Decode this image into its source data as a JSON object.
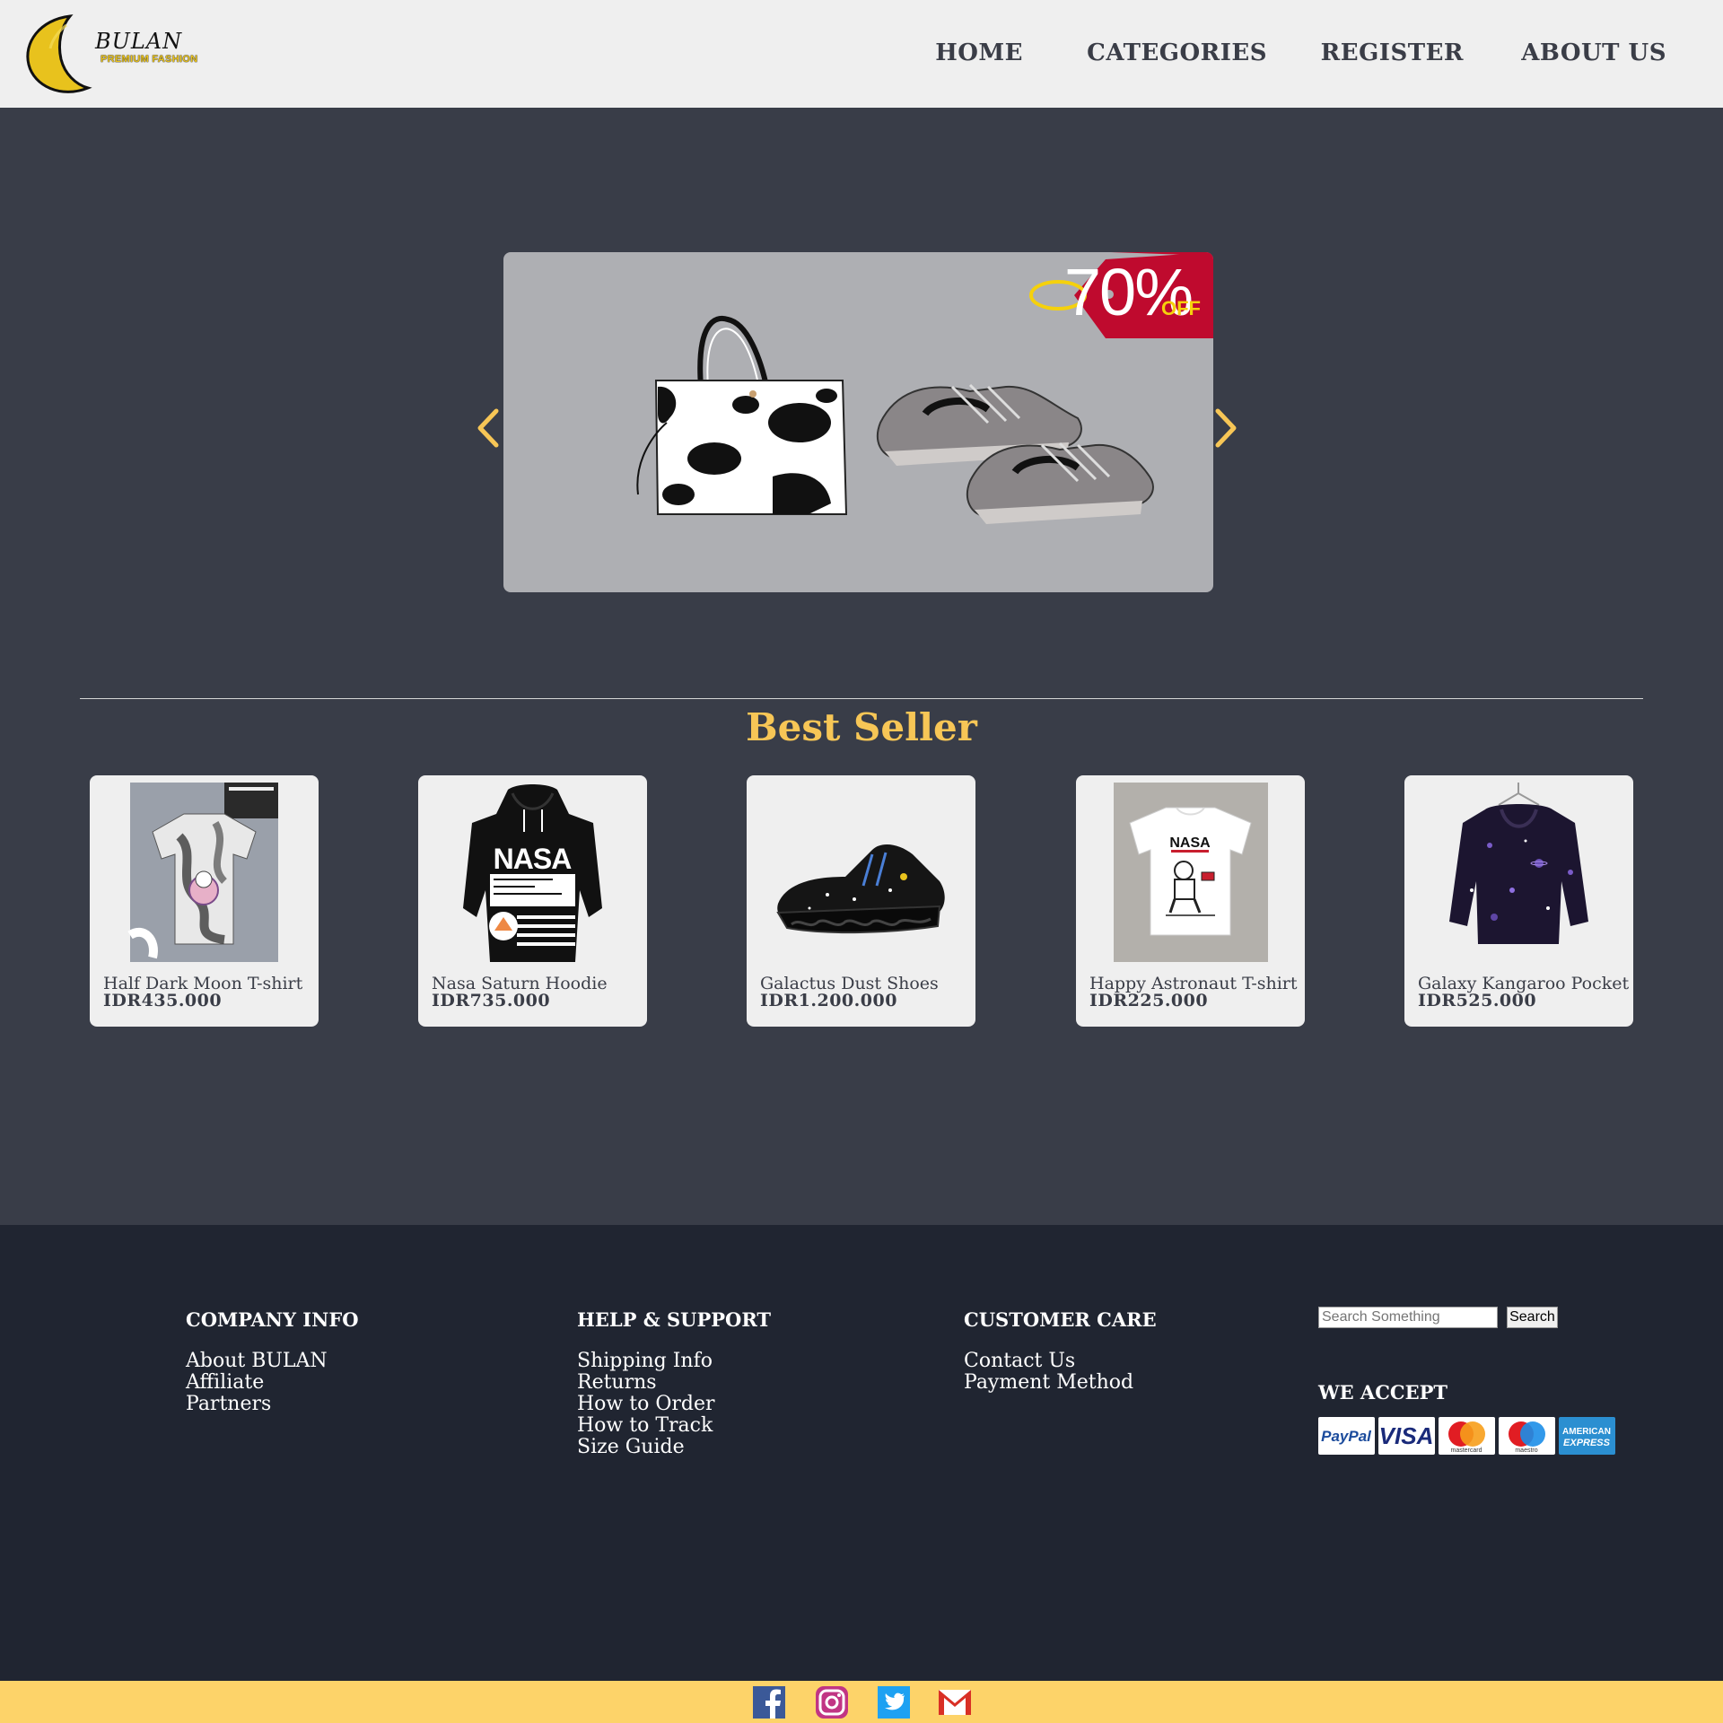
{
  "brand": {
    "name": "BULAN",
    "tagline": "PREMIUM FASHION",
    "accent_color": "#f7c656",
    "moon_color": "#e8c21d"
  },
  "nav": {
    "items": [
      {
        "label": "HOME"
      },
      {
        "label": "CATEGORIES"
      },
      {
        "label": "REGISTER"
      },
      {
        "label": "ABOUT US"
      }
    ]
  },
  "hero": {
    "discount_value": "70%",
    "discount_label": "OFF",
    "tag_color": "#bf0a2e",
    "prev_icon": "chevron-left-icon",
    "next_icon": "chevron-right-icon"
  },
  "best_seller": {
    "title": "Best Seller",
    "products": [
      {
        "name": "Half Dark Moon T-shirt",
        "price": "IDR435.000"
      },
      {
        "name": "Nasa Saturn Hoodie",
        "price": "IDR735.000"
      },
      {
        "name": "Galactus Dust Shoes",
        "price": "IDR1.200.000"
      },
      {
        "name": "Happy Astronaut T-shirt",
        "price": "IDR225.000"
      },
      {
        "name": "Galaxy Kangaroo Pocket",
        "price": "IDR525.000"
      }
    ]
  },
  "footer": {
    "company": {
      "title": "COMPANY INFO",
      "links": [
        "About BULAN",
        "Affiliate",
        "Partners"
      ]
    },
    "help": {
      "title": "HELP & SUPPORT",
      "links": [
        "Shipping Info",
        "Returns",
        "How to Order",
        "How to Track",
        "Size Guide"
      ]
    },
    "care": {
      "title": "CUSTOMER CARE",
      "links": [
        "Contact Us",
        "Payment Method"
      ]
    },
    "search": {
      "placeholder": "Search Something",
      "button_label": "Search"
    },
    "we_accept": {
      "title": "WE ACCEPT",
      "methods": [
        "PayPal",
        "VISA",
        "mastercard",
        "maestro",
        "AMERICAN",
        "EXPRESS"
      ]
    }
  },
  "social": {
    "bar_color": "#fdd369",
    "icons": [
      "facebook-icon",
      "instagram-icon",
      "twitter-icon",
      "gmail-icon"
    ]
  }
}
